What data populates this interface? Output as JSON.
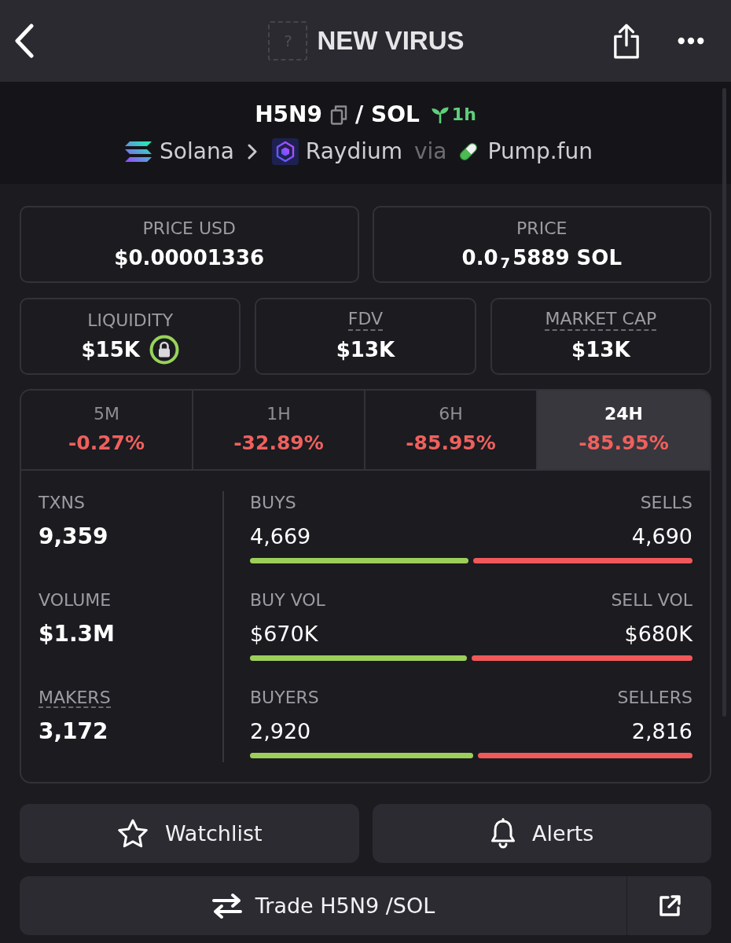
{
  "header": {
    "logo_placeholder": "?",
    "title": "NEW VIRUS"
  },
  "pair": {
    "base": "H5N9",
    "quote": "/ SOL",
    "age": "1h",
    "chain": "Solana",
    "dex": "Raydium",
    "via": "via",
    "launchpad": "Pump.fun"
  },
  "price_cards": [
    {
      "label": "PRICE USD",
      "value": "$0.00001336"
    },
    {
      "label": "PRICE",
      "value": "0.0$_{7}$5889 SOL"
    }
  ],
  "metric_cards": [
    {
      "label": "LIQUIDITY",
      "value": "$15K",
      "underlined": false,
      "locked": true
    },
    {
      "label": "FDV",
      "value": "$13K",
      "underlined": true,
      "locked": false
    },
    {
      "label": "MARKET CAP",
      "value": "$13K",
      "underlined": true,
      "locked": false
    }
  ],
  "timeframe_tabs": [
    {
      "label": "5M",
      "change": "-0.27%",
      "selected": false
    },
    {
      "label": "1H",
      "change": "-32.89%",
      "selected": false
    },
    {
      "label": "6H",
      "change": "-85.95%",
      "selected": false
    },
    {
      "label": "24H",
      "change": "-85.95%",
      "selected": true
    }
  ],
  "totals": [
    {
      "label": "TXNS",
      "value": "9,359",
      "underlined": false
    },
    {
      "label": "VOLUME",
      "value": "$1.3M",
      "underlined": false
    },
    {
      "label": "MAKERS",
      "value": "3,172",
      "underlined": true
    }
  ],
  "splits": [
    {
      "buy_label": "BUYS",
      "buy_value": "4,669",
      "sell_label": "SELLS",
      "sell_value": "4,690",
      "level": 0.499
    },
    {
      "buy_label": "BUY VOL",
      "buy_value": "$670K",
      "sell_label": "SELL VOL",
      "sell_value": "$680K",
      "level": 0.496
    },
    {
      "buy_label": "BUYERS",
      "buy_value": "2,920",
      "sell_label": "SELLERS",
      "sell_value": "2,816",
      "level": 0.509
    }
  ],
  "actions": [
    {
      "kind": "watchlist",
      "label": "Watchlist"
    },
    {
      "kind": "alerts",
      "label": "Alerts"
    }
  ],
  "trade": {
    "label": "Trade H5N9 /SOL"
  }
}
